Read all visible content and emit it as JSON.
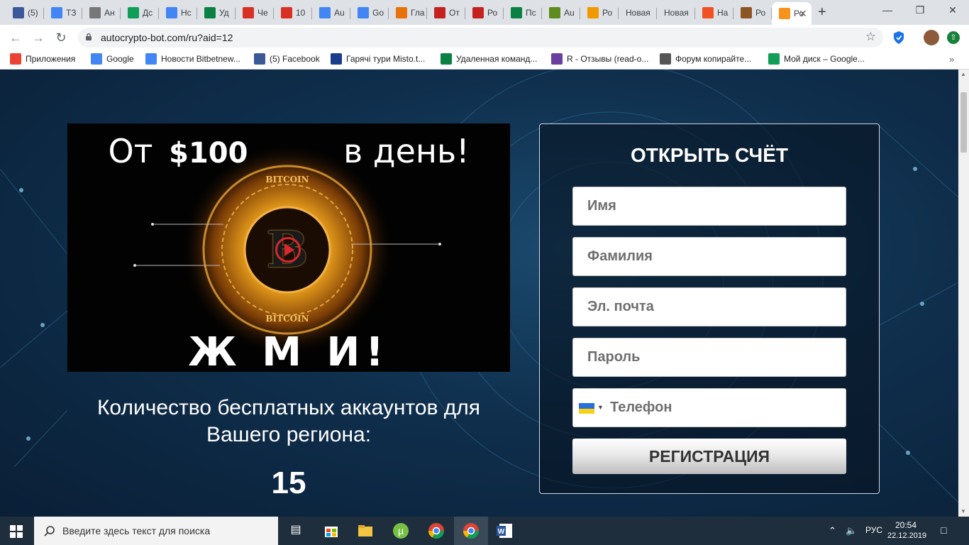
{
  "browser": {
    "tabs": [
      {
        "label": "(5)",
        "icon": "facebook-icon",
        "color": "#3b5998"
      },
      {
        "label": "ТЗ",
        "icon": "docs-icon",
        "color": "#4285f4"
      },
      {
        "label": "Ан",
        "icon": "eye-icon",
        "color": "#777777"
      },
      {
        "label": "Дс",
        "icon": "drive-icon",
        "color": "#0f9d58"
      },
      {
        "label": "Нс",
        "icon": "docs-icon",
        "color": "#4285f4"
      },
      {
        "label": "Уд",
        "icon": "plus-cross-icon",
        "color": "#0b8043"
      },
      {
        "label": "Че",
        "icon": "gmail-icon",
        "color": "#d93025"
      },
      {
        "label": "10",
        "icon": "copyright-icon",
        "color": "#d93025"
      },
      {
        "label": "Au",
        "icon": "google-icon",
        "color": "#4285f4"
      },
      {
        "label": "Go",
        "icon": "translate-icon",
        "color": "#4285f4"
      },
      {
        "label": "Гла",
        "icon": "bird-icon",
        "color": "#e8710a"
      },
      {
        "label": "От",
        "icon": "fm-icon",
        "color": "#c5221f"
      },
      {
        "label": "Ро",
        "icon": "check-icon",
        "color": "#c5221f"
      },
      {
        "label": "Пс",
        "icon": "check-icon",
        "color": "#0b8043"
      },
      {
        "label": "Au",
        "icon": "shield-icon",
        "color": "#5f8c1f"
      },
      {
        "label": "Ро",
        "icon": "bolt-icon",
        "color": "#f29900"
      },
      {
        "label": "Новая",
        "icon": "",
        "color": ""
      },
      {
        "label": "Новая",
        "icon": "",
        "color": ""
      },
      {
        "label": "На",
        "icon": "windows-icon",
        "color": "#f25022"
      },
      {
        "label": "Ро",
        "icon": "helmet-icon",
        "color": "#8d5524"
      },
      {
        "label": "Ро",
        "icon": "bitcoin-icon",
        "color": "#f7931a"
      }
    ],
    "url": "autocrypto-bot.com/ru?aid=12",
    "bookmarks": [
      {
        "label": "Приложения",
        "icon": "apps-grid-icon"
      },
      {
        "label": "Google",
        "icon": "google-icon"
      },
      {
        "label": "Новости Bitbetnew...",
        "icon": "docs-icon"
      },
      {
        "label": "(5) Facebook",
        "icon": "facebook-icon"
      },
      {
        "label": "Гарячі тури Misto.t...",
        "icon": "m-icon"
      },
      {
        "label": "Удаленная команд...",
        "icon": "plus-cross-icon"
      },
      {
        "label": "R - Отзывы (read-o...",
        "icon": "r-icon"
      },
      {
        "label": "Форум копирайте...",
        "icon": "owl-icon"
      },
      {
        "label": "Мой диск – Google...",
        "icon": "drive-icon"
      }
    ]
  },
  "page": {
    "promo": {
      "headline_from": "От",
      "headline_amount": "$100",
      "headline_rest": "в  день!",
      "coin_label_top": "BITCOIN",
      "coin_label_bottom": "BITCOIN",
      "cta": "Ж М И!"
    },
    "counter": {
      "text": "Количество бесплатных аккаунтов для Вашего региона:",
      "value": "15"
    },
    "form": {
      "title": "ОТКРЫТЬ СЧЁТ",
      "first_name_placeholder": "Имя",
      "last_name_placeholder": "Фамилия",
      "email_placeholder": "Эл. почта",
      "password_placeholder": "Пароль",
      "phone_placeholder": "Телефон",
      "submit_label": "РЕГИСТРАЦИЯ"
    }
  },
  "taskbar": {
    "search_placeholder": "Введите здесь текст для поиска",
    "language": "РУС",
    "time": "20:54",
    "date": "22.12.2019"
  }
}
